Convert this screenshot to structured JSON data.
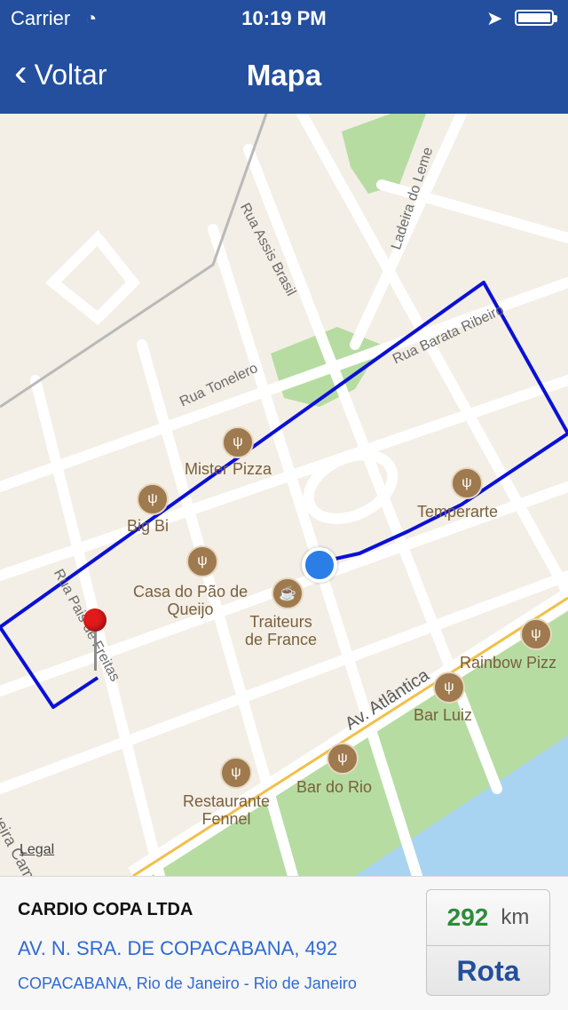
{
  "status_bar": {
    "carrier": "Carrier",
    "time": "10:19 PM"
  },
  "nav": {
    "back_label": "Voltar",
    "back_icon": "chevron-left-icon",
    "title": "Mapa"
  },
  "map": {
    "streets": [
      "Rua Assis Brasil",
      "Ladeira do Leme",
      "Rua Barata Ribeiro",
      "Rua Tonelero",
      "Av. Atlântica",
      "Rua Pais de Freitas",
      "Siqueira Campos"
    ],
    "pois": [
      {
        "label": "Mister Pizza"
      },
      {
        "label": "Big Bi"
      },
      {
        "label": "Casa do Pão de\nQueijo"
      },
      {
        "label": "Traiteurs\nde France"
      },
      {
        "label": "Temperarte"
      },
      {
        "label": "Rainbow Pizz"
      },
      {
        "label": "Bar Luiz"
      },
      {
        "label": "Bar do Rio"
      },
      {
        "label": "Restaurante\nFennel"
      }
    ],
    "legal": "Legal",
    "route_color": "#0a10d6",
    "beach_color": "#b6dca2",
    "sea_color": "#a9d4f1"
  },
  "footer": {
    "company": "CARDIO COPA LTDA",
    "address": "AV. N. SRA. DE COPACABANA, 492",
    "city": "COPACABANA, Rio de Janeiro - Rio de Janeiro",
    "distance_value": "292",
    "distance_unit": "km",
    "route_button": "Rota"
  }
}
